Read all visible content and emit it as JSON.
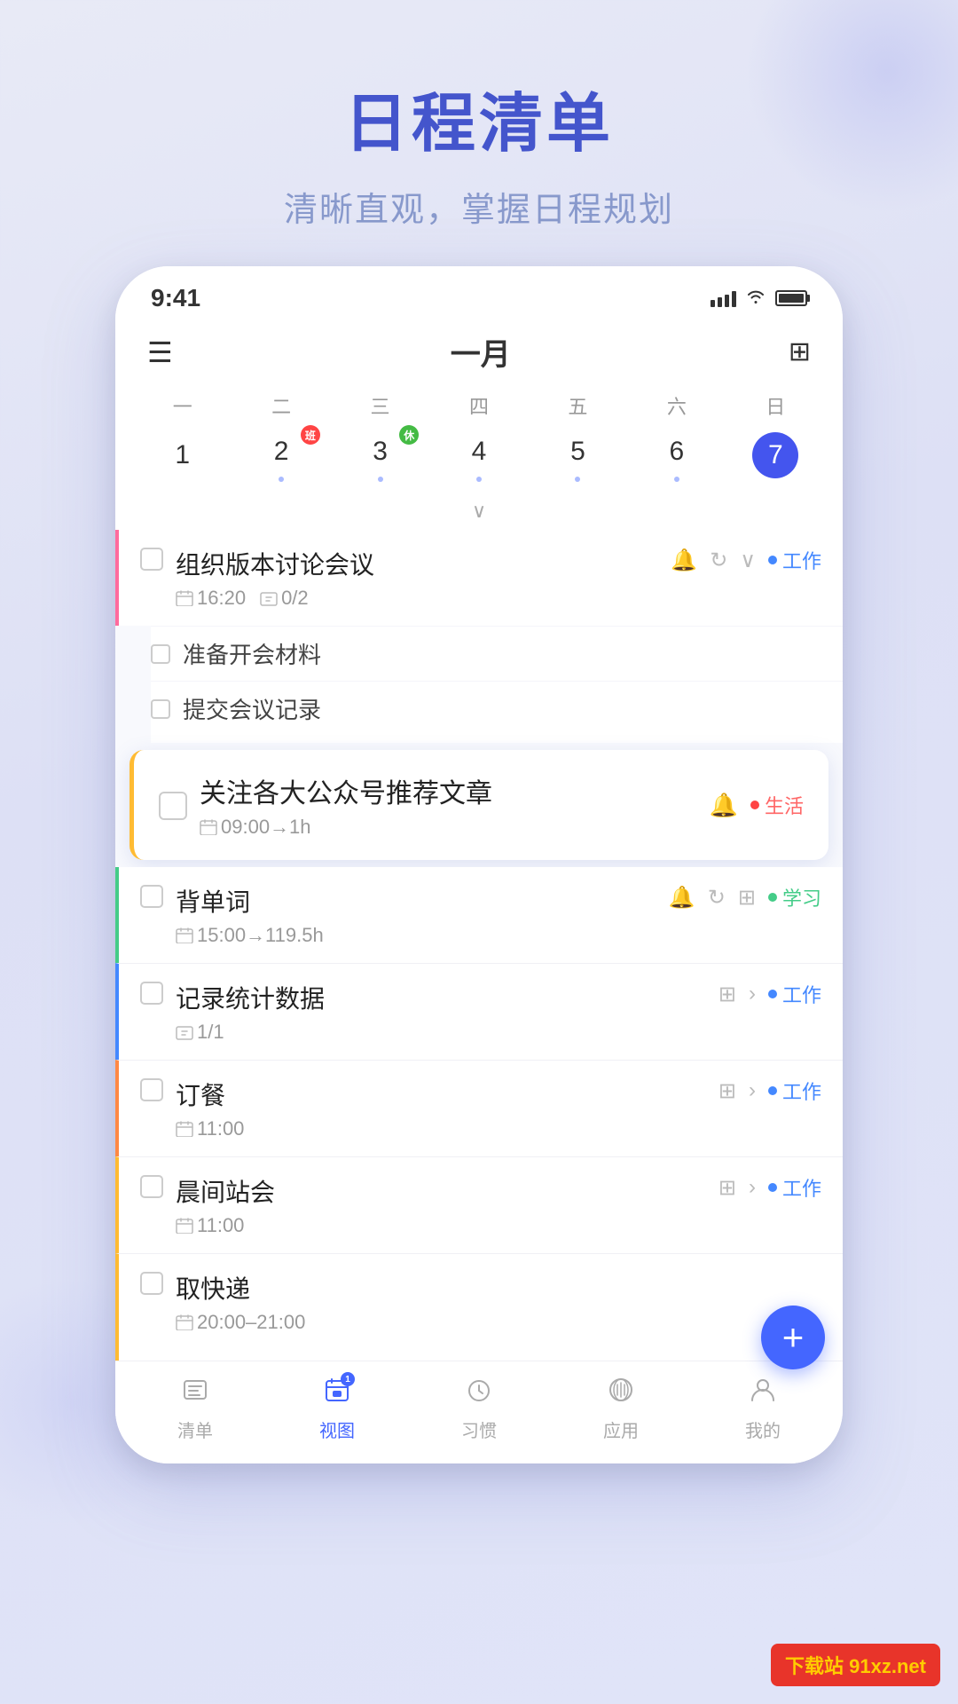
{
  "header": {
    "title": "日程清单",
    "subtitle": "清晰直观，掌握日程规划"
  },
  "statusBar": {
    "time": "9:41",
    "signal": "●●●●",
    "wifi": "wifi",
    "battery": "full"
  },
  "calendar": {
    "month": "一月",
    "weekdays": [
      "一",
      "二",
      "三",
      "四",
      "五",
      "六",
      "日"
    ],
    "dates": [
      {
        "num": "1",
        "selected": false,
        "badge": null,
        "dot": false
      },
      {
        "num": "2",
        "selected": false,
        "badge": "班",
        "badgeColor": "red",
        "dot": true
      },
      {
        "num": "3",
        "selected": false,
        "badge": "休",
        "badgeColor": "green",
        "dot": true
      },
      {
        "num": "4",
        "selected": false,
        "badge": null,
        "dot": true
      },
      {
        "num": "5",
        "selected": false,
        "badge": null,
        "dot": true
      },
      {
        "num": "6",
        "selected": false,
        "badge": null,
        "dot": true
      },
      {
        "num": "7",
        "selected": true,
        "badge": null,
        "dot": false
      }
    ]
  },
  "tasks": [
    {
      "id": "task1",
      "title": "组织版本讨论会议",
      "time": "16:20",
      "subtaskCount": "0/2",
      "tag": "工作",
      "tagColor": "blue",
      "borderColor": "pink",
      "hasAlarm": true,
      "hasRepeat": true,
      "subtasks": [
        {
          "title": "准备开会材料"
        },
        {
          "title": "提交会议记录"
        }
      ]
    },
    {
      "id": "task2",
      "title": "关注各大公众号推荐文章",
      "time": "09:00→1h",
      "tag": "生活",
      "tagColor": "red",
      "borderColor": "yellow",
      "highlighted": true,
      "hasAlarm": true
    },
    {
      "id": "task3",
      "title": "背单词",
      "time": "15:00→119.5h",
      "tag": "学习",
      "tagColor": "green",
      "borderColor": "green",
      "hasAlarm": true,
      "hasRepeat": true,
      "hasGrid": true
    },
    {
      "id": "task4",
      "title": "记录统计数据",
      "subtaskCount": "1/1",
      "tag": "工作",
      "tagColor": "blue",
      "borderColor": "blue",
      "hasGrid": true,
      "hasArrow": true
    },
    {
      "id": "task5",
      "title": "订餐",
      "time": "11:00",
      "tag": "工作",
      "tagColor": "blue",
      "borderColor": "orange",
      "hasGrid": true,
      "hasArrow": true
    },
    {
      "id": "task6",
      "title": "晨间站会",
      "time": "11:00",
      "tag": "工作",
      "tagColor": "blue",
      "borderColor": "yellow",
      "hasGrid": true,
      "hasArrow": true
    },
    {
      "id": "task7",
      "title": "取快递",
      "time": "20:00–21:00",
      "borderColor": "yellow"
    }
  ],
  "bottomNav": {
    "items": [
      {
        "label": "清单",
        "icon": "list",
        "active": false
      },
      {
        "label": "视图",
        "icon": "calendar",
        "active": true,
        "badge": "1"
      },
      {
        "label": "习惯",
        "icon": "clock",
        "active": false
      },
      {
        "label": "应用",
        "icon": "apps",
        "active": false
      },
      {
        "label": "我的",
        "icon": "user",
        "active": false
      }
    ]
  },
  "fab": {
    "label": "+"
  },
  "watermark": {
    "text": "91xz.net",
    "prefix": "下载站"
  }
}
